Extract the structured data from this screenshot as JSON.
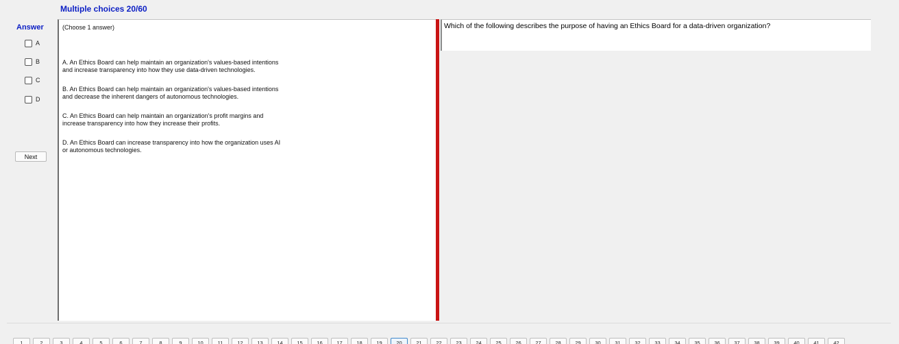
{
  "header": {
    "title": "Multiple choices 20/60"
  },
  "answer_panel": {
    "label": "Answer",
    "options": [
      {
        "letter": "A",
        "checked": false
      },
      {
        "letter": "B",
        "checked": false
      },
      {
        "letter": "C",
        "checked": false
      },
      {
        "letter": "D",
        "checked": false
      }
    ],
    "next_label": "Next"
  },
  "choices": {
    "instruction": "(Choose 1 answer)",
    "items": [
      {
        "letter": "A",
        "line1": "A.  An Ethics Board can help maintain an organization's values-based intentions",
        "line2": "and increase transparency into how they use data-driven technologies."
      },
      {
        "letter": "B",
        "line1": "B.  An Ethics Board can help maintain an organization's values-based intentions",
        "line2": "and decrease the inherent dangers of autonomous technologies."
      },
      {
        "letter": "C",
        "line1": "C.  An Ethics Board can help maintain an organization's profit margins and",
        "line2": "increase transparency into how they increase their profits."
      },
      {
        "letter": "D",
        "line1": "D.  An Ethics Board can increase transparency into how the organization uses AI",
        "line2": "or autonomous technologies."
      }
    ]
  },
  "question": {
    "text": "Which of the following describes the purpose of having an Ethics Board for a data-driven organization?"
  },
  "pagination": {
    "current": "20",
    "pages": [
      "1",
      "2",
      "3",
      "4",
      "5",
      "6",
      "7",
      "8",
      "9",
      "10",
      "11",
      "12",
      "13",
      "14",
      "15",
      "16",
      "17",
      "18",
      "19",
      "20",
      "21",
      "22",
      "23",
      "24",
      "25",
      "26",
      "27",
      "28",
      "29",
      "30",
      "31",
      "32",
      "33",
      "34",
      "35",
      "36",
      "37",
      "38",
      "39",
      "40",
      "41",
      "42"
    ]
  },
  "colors": {
    "accent_blue": "#0b1ec4",
    "splitter_red": "#c91414"
  }
}
